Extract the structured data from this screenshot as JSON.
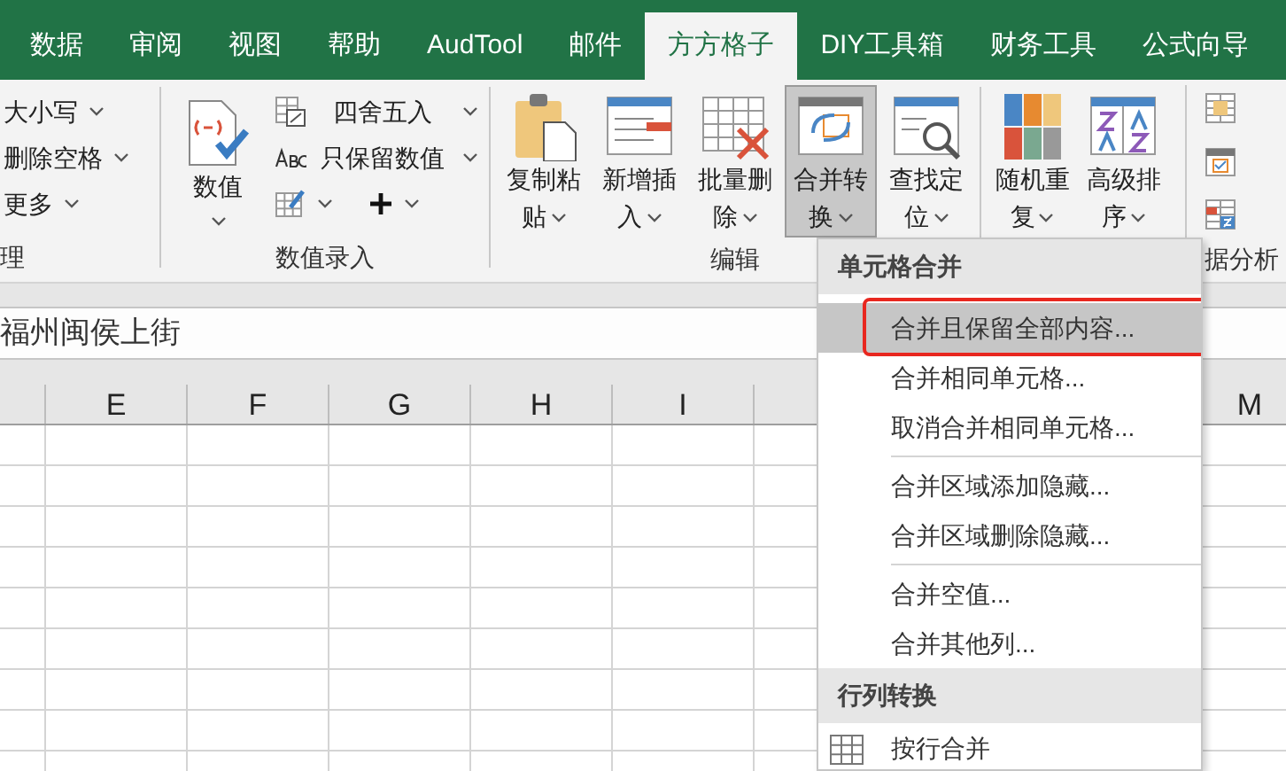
{
  "tabs": [
    {
      "label": "数据",
      "selected": false
    },
    {
      "label": "审阅",
      "selected": false
    },
    {
      "label": "视图",
      "selected": false
    },
    {
      "label": "帮助",
      "selected": false
    },
    {
      "label": "AudTool",
      "selected": false
    },
    {
      "label": "邮件",
      "selected": false
    },
    {
      "label": "方方格子",
      "selected": true
    },
    {
      "label": "DIY工具箱",
      "selected": false
    },
    {
      "label": "财务工具",
      "selected": false
    },
    {
      "label": "公式向导",
      "selected": false
    }
  ],
  "ribbon": {
    "groups": [
      {
        "label": "理",
        "items": [
          {
            "kind": "small",
            "label": "大小写"
          },
          {
            "kind": "small",
            "label": "删除空格"
          },
          {
            "kind": "small",
            "label": "更多"
          }
        ]
      },
      {
        "label": "数值录入",
        "items": [
          {
            "kind": "tall",
            "label": "数值",
            "pressed": false
          },
          {
            "kind": "small",
            "label": "四舍五入"
          },
          {
            "kind": "small",
            "label": "只保留数值"
          },
          {
            "kind": "iconrow"
          }
        ]
      },
      {
        "label": "编辑",
        "items": [
          {
            "kind": "large",
            "label": "复制粘贴",
            "pressed": false
          },
          {
            "kind": "large",
            "label": "新增插入",
            "pressed": false
          },
          {
            "kind": "large",
            "label": "批量删除",
            "pressed": false
          },
          {
            "kind": "large",
            "label": "合并转换",
            "pressed": true
          },
          {
            "kind": "large",
            "label": "查找定位",
            "pressed": false
          }
        ]
      },
      {
        "label": "据分析",
        "items": [
          {
            "kind": "large",
            "label": "随机重复",
            "pressed": false
          },
          {
            "kind": "large",
            "label": "高级排序",
            "pressed": false
          },
          {
            "kind": "iconcol"
          }
        ]
      }
    ]
  },
  "formula_bar": {
    "value": "福州闽侯上街"
  },
  "sheet": {
    "columns": [
      "E",
      "F",
      "G",
      "H",
      "I",
      "M"
    ]
  },
  "menu": {
    "sections": [
      {
        "title": "单元格合并",
        "items": [
          {
            "kind": "item",
            "label": "合并且保留全部内容...",
            "selected": true
          },
          {
            "kind": "item",
            "label": "合并相同单元格...",
            "selected": false
          },
          {
            "kind": "item",
            "label": "取消合并相同单元格...",
            "selected": false
          },
          {
            "kind": "separator"
          },
          {
            "kind": "item",
            "label": "合并区域添加隐藏...",
            "selected": false
          },
          {
            "kind": "item",
            "label": "合并区域删除隐藏...",
            "selected": false
          },
          {
            "kind": "separator"
          },
          {
            "kind": "item",
            "label": "合并空值...",
            "selected": false
          },
          {
            "kind": "item",
            "label": "合并其他列...",
            "selected": false
          }
        ]
      },
      {
        "title": "行列转换",
        "items": [
          {
            "kind": "icon_item",
            "label": "按行合并",
            "selected": false
          }
        ]
      }
    ]
  }
}
